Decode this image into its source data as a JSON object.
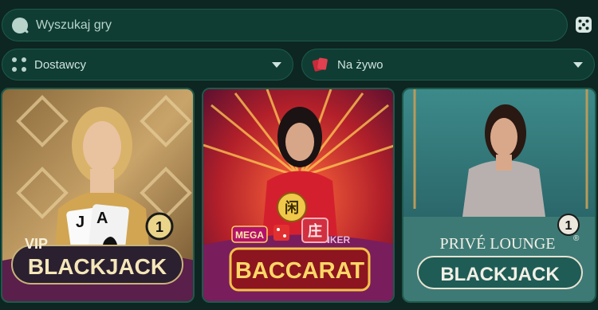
{
  "search": {
    "placeholder": "Wyszukaj gry"
  },
  "filters": {
    "providers_label": "Dostawcy",
    "category_label": "Na żywo"
  },
  "games": [
    {
      "logo_top": "VIP",
      "logo_main": "BLACKJACK",
      "badge": "1",
      "cards": [
        "J",
        "A"
      ]
    },
    {
      "logo_top": "MEGA",
      "logo_main": "BACCARAT",
      "chips": [
        "闲",
        "庄"
      ],
      "table_text": "R ANKER"
    },
    {
      "logo_top": "PRIVÉ LOUNGE",
      "logo_main": "BLACKJACK",
      "badge": "1",
      "trademark": "®"
    }
  ],
  "colors": {
    "background": "#0d2621",
    "field": "#0f3d33",
    "field_border": "#1d5a4c",
    "text": "#cfe3dc"
  }
}
